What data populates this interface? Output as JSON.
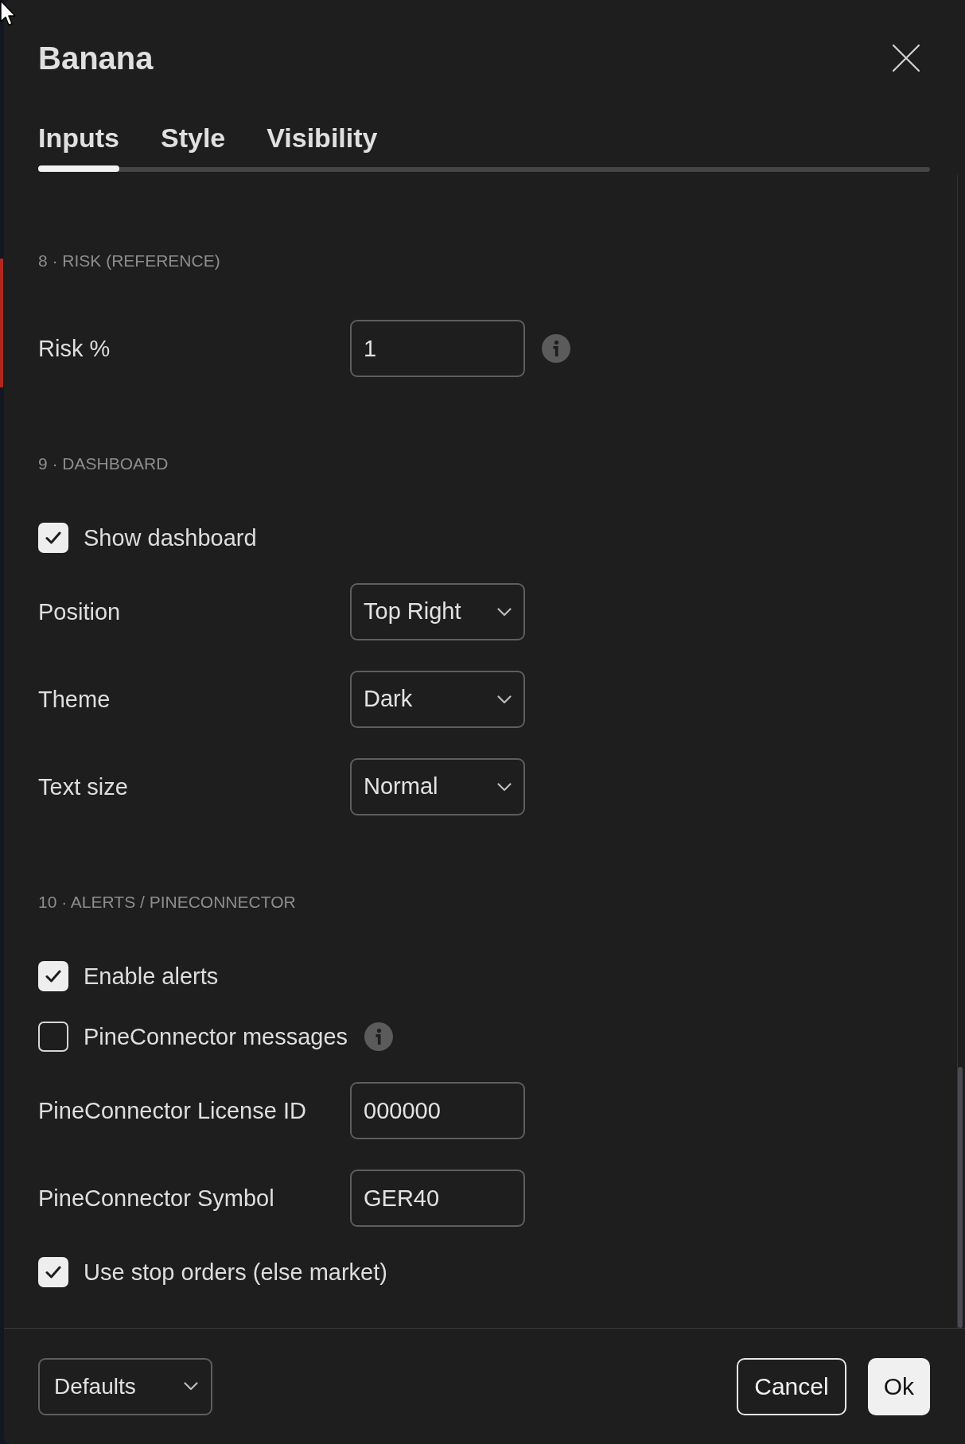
{
  "dialog": {
    "title": "Banana"
  },
  "tabs": [
    {
      "label": "Inputs",
      "selected": true
    },
    {
      "label": "Style",
      "selected": false
    },
    {
      "label": "Visibility",
      "selected": false
    }
  ],
  "sections": [
    {
      "header": "8 · RISK (REFERENCE)",
      "items": [
        {
          "kind": "field",
          "label": "Risk %",
          "value": "1",
          "info": true
        }
      ]
    },
    {
      "header": "9 · DASHBOARD",
      "items": [
        {
          "kind": "checkbox",
          "label": "Show dashboard",
          "checked": true
        },
        {
          "kind": "select",
          "label": "Position",
          "value": "Top Right"
        },
        {
          "kind": "select",
          "label": "Theme",
          "value": "Dark"
        },
        {
          "kind": "select",
          "label": "Text size",
          "value": "Normal"
        }
      ]
    },
    {
      "header": "10 · ALERTS / PINECONNECTOR",
      "items": [
        {
          "kind": "checkbox",
          "label": "Enable alerts",
          "checked": true
        },
        {
          "kind": "checkbox",
          "label": "PineConnector messages",
          "checked": false,
          "info": true
        },
        {
          "kind": "field",
          "label": "PineConnector License ID",
          "value": "000000"
        },
        {
          "kind": "field",
          "label": "PineConnector Symbol",
          "value": "GER40"
        },
        {
          "kind": "checkbox",
          "label": "Use stop orders (else market)",
          "checked": true
        }
      ]
    }
  ],
  "footer": {
    "preset": "Defaults",
    "buttons": [
      {
        "label": "Cancel",
        "kind": "secondary"
      },
      {
        "label": "Ok",
        "kind": "primary"
      }
    ]
  }
}
